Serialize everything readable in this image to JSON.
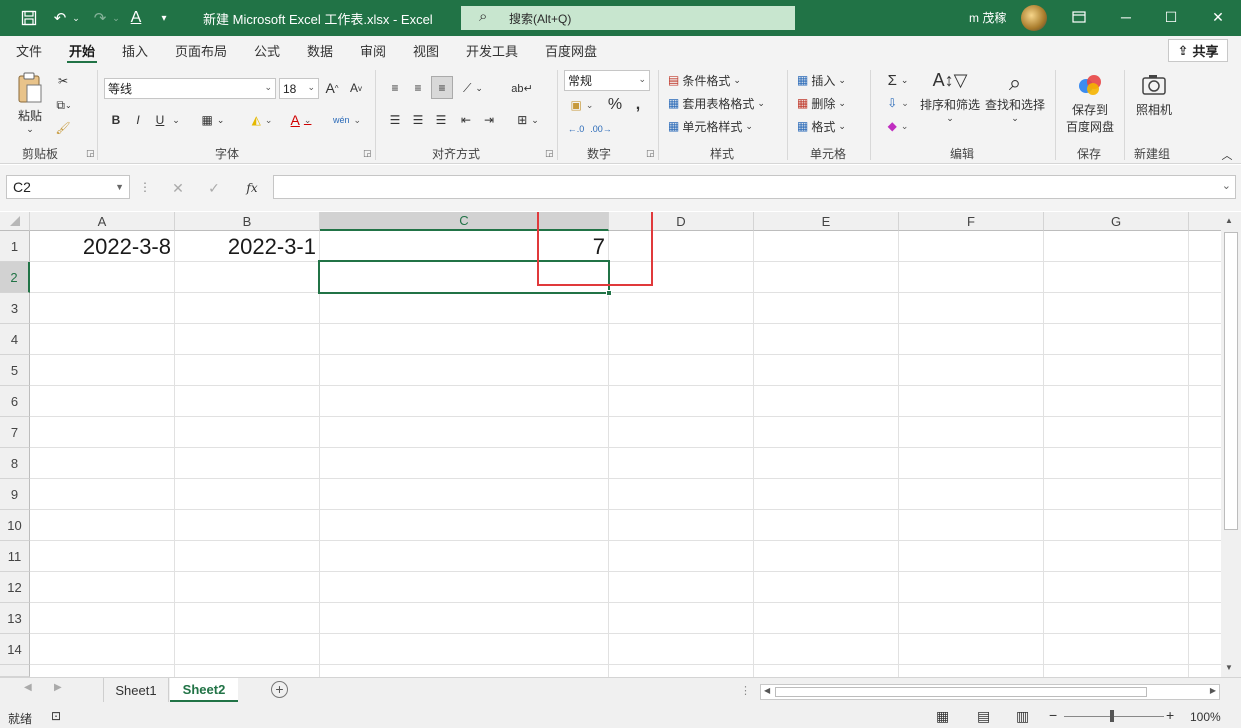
{
  "window": {
    "title": "新建 Microsoft Excel 工作表.xlsx  -  Excel",
    "search_placeholder": "搜索(Alt+Q)",
    "user": "m 茂稼",
    "accent": "#217346"
  },
  "menu_tabs": [
    "文件",
    "开始",
    "插入",
    "页面布局",
    "公式",
    "数据",
    "审阅",
    "视图",
    "开发工具",
    "百度网盘"
  ],
  "share_label": "共享",
  "ribbon": {
    "clipboard": {
      "label": "剪贴板",
      "paste": "粘贴"
    },
    "font": {
      "label": "字体",
      "font_name": "等线",
      "font_size": "18",
      "bold": "B",
      "italic": "I",
      "underline": "U"
    },
    "alignment": {
      "label": "对齐方式"
    },
    "number": {
      "label": "数字",
      "format": "常规"
    },
    "styles": {
      "label": "样式",
      "conditional": "条件格式",
      "table": "套用表格格式",
      "cell": "单元格样式"
    },
    "cells": {
      "label": "单元格",
      "insert": "插入",
      "delete": "删除",
      "format": "格式"
    },
    "editing": {
      "label": "编辑",
      "sort": "排序和筛选",
      "find": "查找和选择"
    },
    "save": {
      "label": "保存",
      "button_line1": "保存到",
      "button_line2": "百度网盘"
    },
    "newgroup": {
      "label": "新建组",
      "camera": "照相机"
    }
  },
  "formula_bar": {
    "name_box": "C2",
    "fx": "fx",
    "formula": ""
  },
  "columns": [
    "A",
    "B",
    "C",
    "D",
    "E",
    "F",
    "G"
  ],
  "rows": [
    "1",
    "2",
    "3",
    "4",
    "5",
    "6",
    "7",
    "8",
    "9",
    "10",
    "11",
    "12",
    "13",
    "14"
  ],
  "cells": {
    "A1": "2022-3-8",
    "B1": "2022-3-1",
    "C1": "7"
  },
  "selected_cell": "C2",
  "sheets": [
    "Sheet1",
    "Sheet2"
  ],
  "active_sheet": "Sheet2",
  "status": {
    "ready": "就绪",
    "zoom": "100%"
  }
}
